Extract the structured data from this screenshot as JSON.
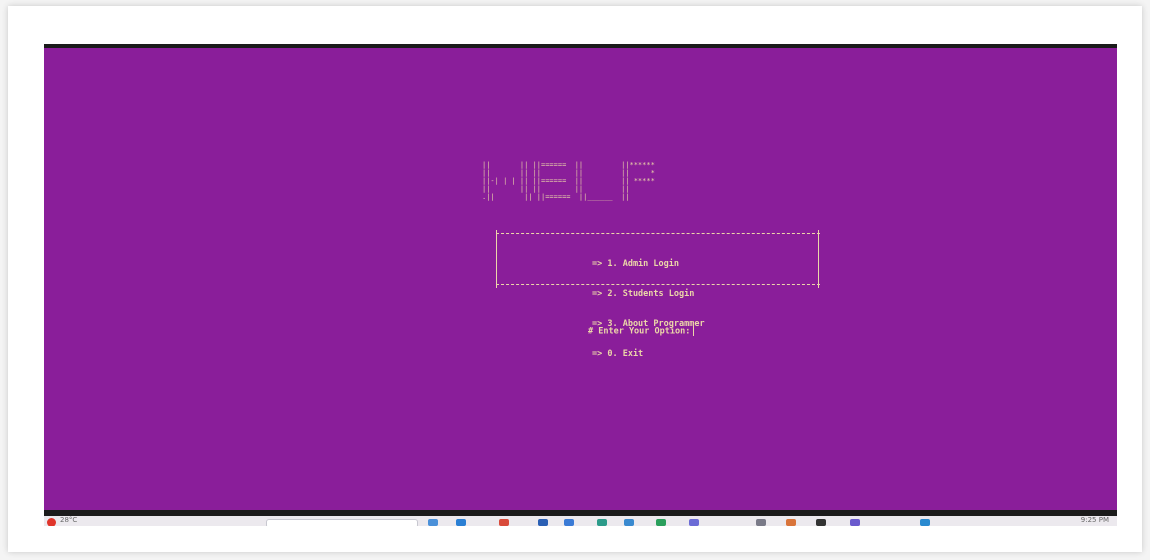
{
  "console": {
    "background_color": "#8a1e9a",
    "text_color": "#ecd6a9",
    "banner": "||       || ||======  ||         ||******\n||       || ||        ||         ||     *\n||-| | | || ||======  ||         || *****\n||       || ||        ||         ||\n.||       || ||======  ||______  ||",
    "menu": {
      "items": [
        "=> 1. Admin Login",
        "=> 2. Students Login",
        "=> 3. About Programmer",
        "=> 0. Exit"
      ]
    },
    "prompt": "# Enter Your Option:"
  },
  "taskbar": {
    "weather_text": "28°C",
    "clock_text": "9:25 PM",
    "icons": [
      {
        "name": "file-explorer-icon",
        "color": "#4a90d9"
      },
      {
        "name": "edge-icon",
        "color": "#2a7fd4"
      },
      {
        "name": "chrome-icon",
        "color": "#d94a3a"
      },
      {
        "name": "app-icon",
        "color": "#2a5fb4"
      },
      {
        "name": "store-icon",
        "color": "#3b7bd6"
      },
      {
        "name": "terminal-icon",
        "color": "#2c9b8a"
      },
      {
        "name": "mail-icon",
        "color": "#3a8ad0"
      },
      {
        "name": "photos-icon",
        "color": "#2a9f5c"
      },
      {
        "name": "media-icon",
        "color": "#6b6bd6"
      },
      {
        "name": "settings-icon",
        "color": "#7a7a88"
      },
      {
        "name": "browser-icon",
        "color": "#d9743a"
      },
      {
        "name": "console-icon",
        "color": "#333333"
      },
      {
        "name": "teams-icon",
        "color": "#6a5acd"
      },
      {
        "name": "code-icon",
        "color": "#2a8ad0"
      }
    ]
  }
}
